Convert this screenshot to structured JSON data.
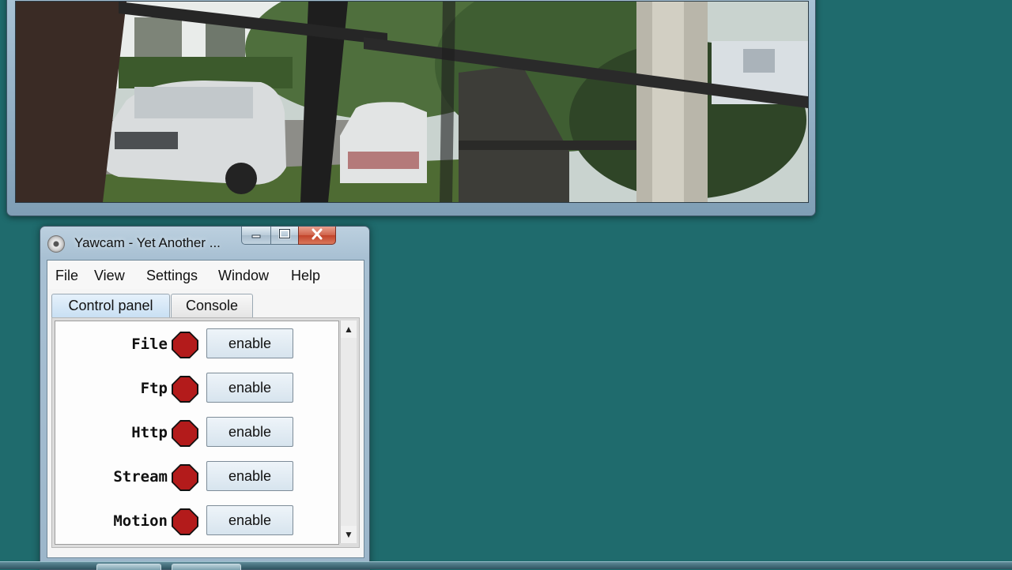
{
  "window": {
    "title": "Yawcam - Yet Another ...",
    "icon": "webcam-icon",
    "controls": {
      "minimize": "minimize-icon",
      "maximize": "maximize-icon",
      "close": "close-icon"
    }
  },
  "menu": [
    "File",
    "View",
    "Settings",
    "Window",
    "Help"
  ],
  "tabs": [
    {
      "label": "Control panel",
      "selected": true
    },
    {
      "label": "Console",
      "selected": false
    }
  ],
  "control_panel": {
    "rows": [
      {
        "label": "File",
        "status": "disabled",
        "button": "enable"
      },
      {
        "label": "Ftp",
        "status": "disabled",
        "button": "enable"
      },
      {
        "label": "Http",
        "status": "disabled",
        "button": "enable"
      },
      {
        "label": "Stream",
        "status": "disabled",
        "button": "enable"
      },
      {
        "label": "Motion",
        "status": "disabled",
        "button": "enable"
      }
    ],
    "status_color": "#b31b1b"
  },
  "colors": {
    "desktop": "#1f6b6d",
    "status_off": "#b31b1b"
  }
}
